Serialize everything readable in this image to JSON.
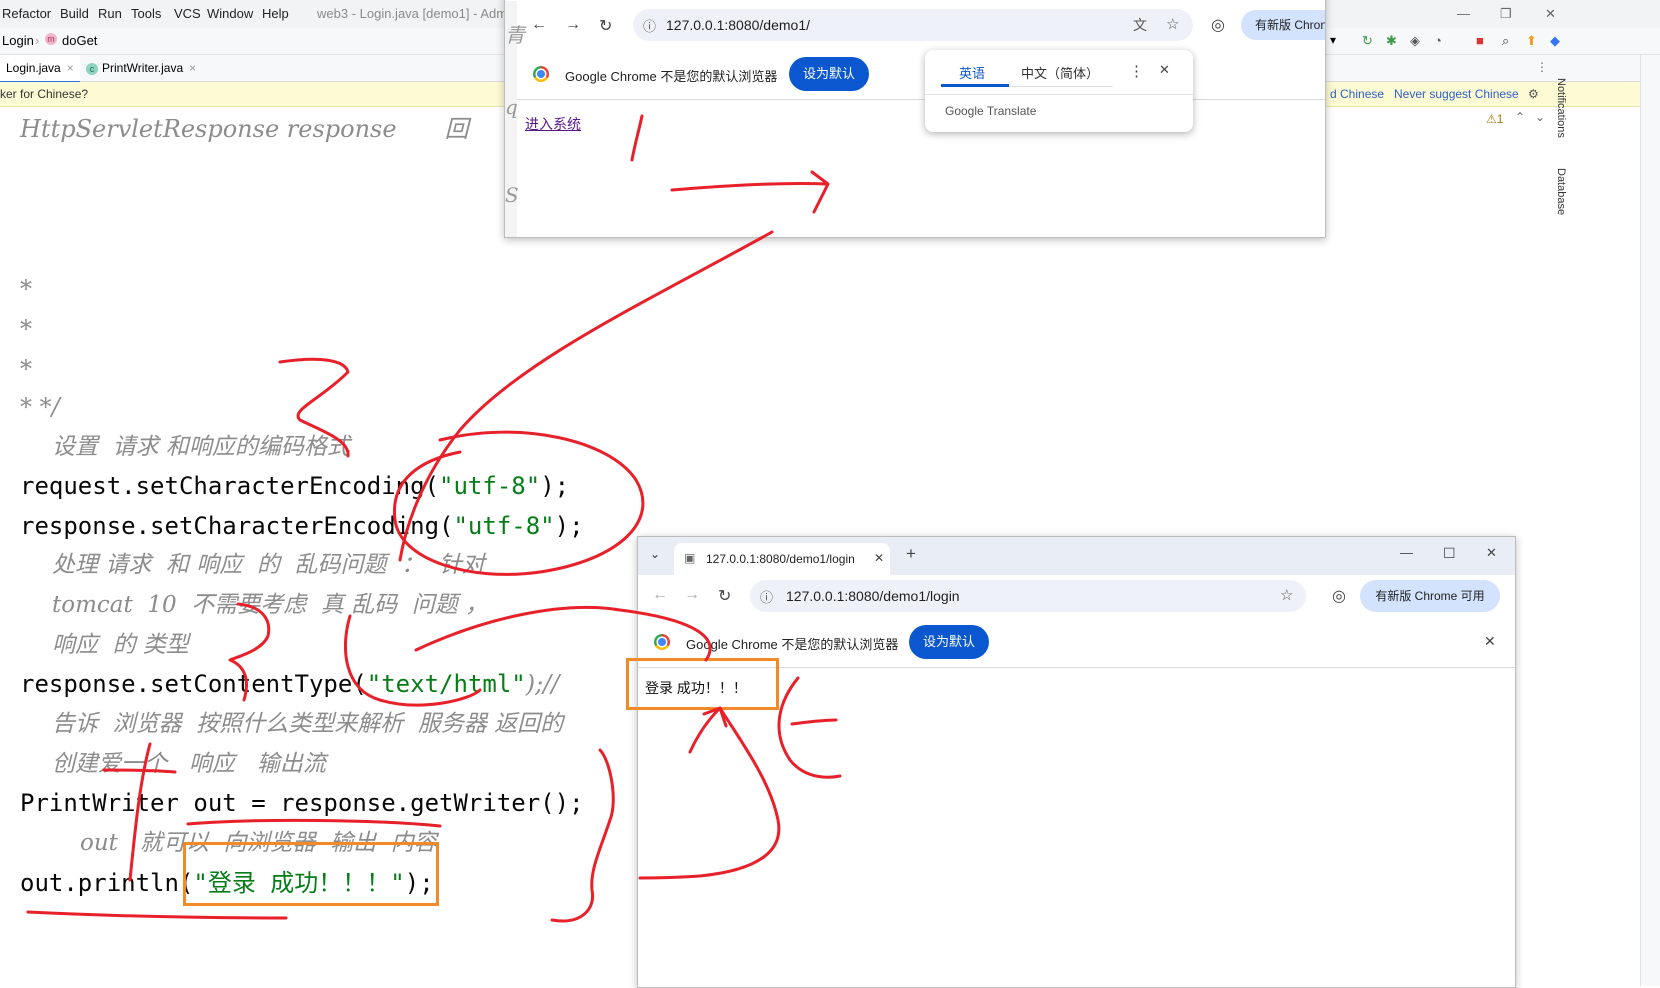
{
  "ide": {
    "menu": [
      "Refactor",
      "Build",
      "Run",
      "Tools",
      "VCS",
      "Window",
      "Help"
    ],
    "window_title": "web3 - Login.java [demo1] - Admi",
    "breadcrumb": [
      "Login",
      "doGet"
    ],
    "method_badge": "m",
    "tabs": [
      {
        "label": "Login.java",
        "close": "×"
      },
      {
        "label": "PrintWriter.java",
        "close": "×",
        "icon": "c"
      }
    ],
    "notice": {
      "text": "ker for Chinese?",
      "link1": "d Chinese",
      "link2": "Never suggest Chinese"
    },
    "warning_count": "⚠1",
    "side_panels": [
      "Notifications",
      "Database"
    ],
    "code": {
      "line1": "HttpServletResponse response",
      "line1_tail": "回",
      "star1": "*",
      "star2": "*",
      "star3": "*",
      "star4": "* */",
      "c1": "设置  请求 和响应的编码格式",
      "l_req": "request.setCharacterEncoding(",
      "l_req_str": "\"utf-8\"",
      "l_req_end": ");",
      "l_resp": "response.setCharacterEncoding(",
      "l_resp_str": "\"utf-8\"",
      "l_resp_end": ");",
      "c2": "处理 请求  和 响应  的  乱码问题  ：  针对  ",
      "c3": "tomcat  10  不需要考虑  真 乱码  问题 ，",
      "c4": "响应  的 类型",
      "l_ct": "response.setContentType(",
      "l_ct_str": "\"text/html\"",
      "l_ct_end": ");//",
      "c5": "告诉  浏览器  按照什么类型来解析  服务器 返回的",
      "c6": "创建爱一个   响应   输出流",
      "l_pw": "PrintWriter out = response.getWriter();",
      "c7": "out   就可以  向浏览器  输出  内容",
      "l_out": "out.println(",
      "l_out_str": "\"登录 成功！！！\"",
      "l_out_end": ");"
    }
  },
  "browser1": {
    "url": "127.0.0.1:8080/demo1/",
    "update_pill": "有新版 Chron",
    "infobar_text": "Google Chrome 不是您的默认浏览器",
    "set_default": "设为默认",
    "link": "进入系统",
    "side_chars": [
      "青",
      "q",
      "S"
    ]
  },
  "translate_popup": {
    "lang1": "英语",
    "lang2": "中文（简体）",
    "brand": "Google Translate",
    "more": "⋮",
    "close": "✕"
  },
  "browser2": {
    "tab_title": "127.0.0.1:8080/demo1/login",
    "url": "127.0.0.1:8080/demo1/login",
    "update_pill": "有新版 Chrome 可用",
    "infobar_text": "Google Chrome 不是您的默认浏览器",
    "set_default": "设为默认",
    "body_text": "登录 成功！！！",
    "new_tab": "+",
    "tab_close": "✕",
    "win_min": "—",
    "win_max": "☐",
    "win_close": "✕",
    "info_close": "✕"
  },
  "colors": {
    "annotation_red": "#e8202a",
    "highlight_orange": "#f28a2a",
    "chrome_blue": "#0b57d0"
  }
}
